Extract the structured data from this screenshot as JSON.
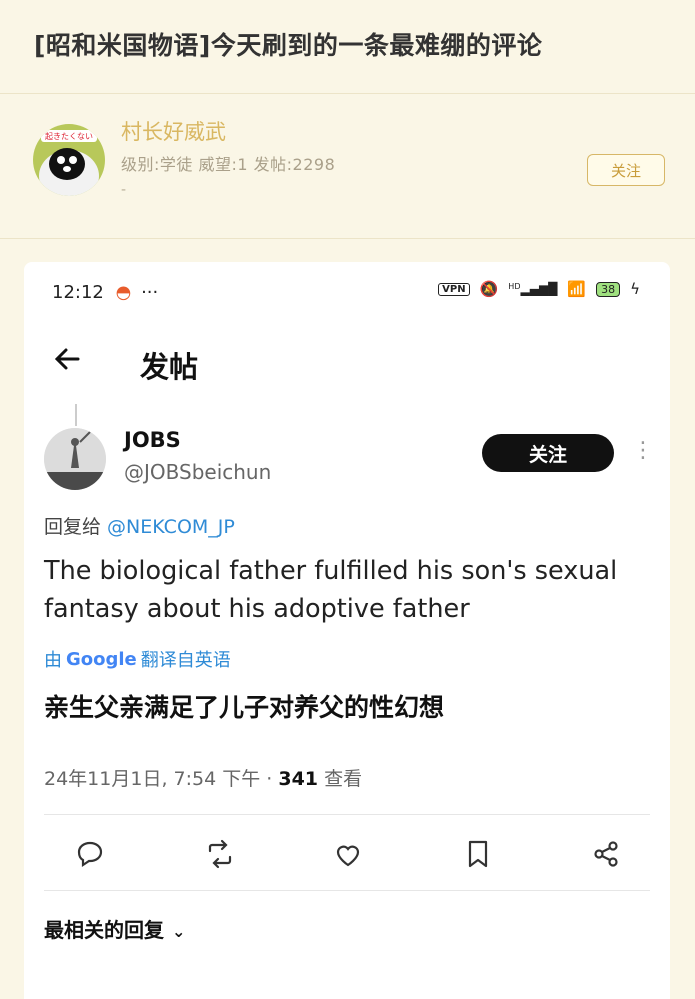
{
  "post": {
    "title": "[昭和米国物语]今天刷到的一条最难绷的评论"
  },
  "author": {
    "name": "村长好威武",
    "meta": "级别:学徒 威望:1 发帖:2298",
    "extra": "-",
    "follow_label": "关注",
    "avatar_text": "起きたくない"
  },
  "screenshot": {
    "status_time": "12:12",
    "status_dots": "···",
    "vpn_label": "VPN",
    "hd_label": "HD",
    "battery_level": "38",
    "nav_title": "发帖",
    "tweet": {
      "display_name": "JOBS",
      "handle": "@JOBSbeichun",
      "follow_label": "关注",
      "reply_prefix": "回复给 ",
      "reply_handle": "@NEKCOM_JP",
      "text": "The biological father fulfilled his son's sexual fantasy about his adoptive father",
      "translate_by": "由",
      "translate_brand": "Google",
      "translate_label": "翻译自英语",
      "translated_text": "亲生父亲满足了儿子对养父的性幻想",
      "timestamp": "24年11月1日, 7:54 下午 · ",
      "views_count": "341",
      "views_label": " 查看"
    },
    "replies_sort_label": "最相关的回复"
  }
}
